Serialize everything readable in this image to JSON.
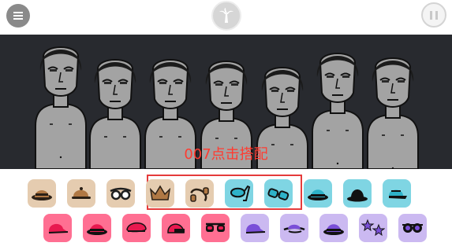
{
  "topbar": {
    "menu_icon": "hamburger-icon",
    "logo_icon": "palm-tree-icon",
    "pause_icon": "pause-icon"
  },
  "stage": {
    "characters": 7,
    "overlay_text": "007点击搭配",
    "overlay_color": "#ff3b30"
  },
  "palette": {
    "row1": [
      {
        "name": "brown-fedora-icon",
        "bg": "#e5ccb0"
      },
      {
        "name": "brown-cap-icon",
        "bg": "#e5ccb0"
      },
      {
        "name": "goggles-icon",
        "bg": "#e5ccb0"
      },
      {
        "name": "crown-icon",
        "bg": "#e5ccb0"
      },
      {
        "name": "headphones-icon",
        "bg": "#e5ccb0"
      },
      {
        "name": "snorkel-mask-icon",
        "bg": "#7fd5e3"
      },
      {
        "name": "cyan-shades-icon",
        "bg": "#7fd5e3"
      },
      {
        "name": "cyan-bowler-hat-icon",
        "bg": "#7fd5e3"
      },
      {
        "name": "black-top-hat-icon",
        "bg": "#7fd5e3"
      },
      {
        "name": "cyan-cap-icon",
        "bg": "#7fd5e3"
      }
    ],
    "row2": [
      {
        "name": "pink-cap-icon",
        "bg": "#ff6f92"
      },
      {
        "name": "pink-bowler-hat-icon",
        "bg": "#ff6f92"
      },
      {
        "name": "pink-beret-icon",
        "bg": "#ff6f92"
      },
      {
        "name": "pink-helmet-icon",
        "bg": "#ff6f92"
      },
      {
        "name": "pink-sunglasses-icon",
        "bg": "#ff6f92"
      },
      {
        "name": "purple-cap-icon",
        "bg": "#cbb9f1"
      },
      {
        "name": "purple-hat-icon",
        "bg": "#cbb9f1"
      },
      {
        "name": "purple-fedora-icon",
        "bg": "#cbb9f1"
      },
      {
        "name": "star-glasses-icon",
        "bg": "#cbb9f1"
      },
      {
        "name": "round-sunglasses-icon",
        "bg": "#cbb9f1"
      }
    ],
    "highlight_color": "#e53b3b"
  }
}
